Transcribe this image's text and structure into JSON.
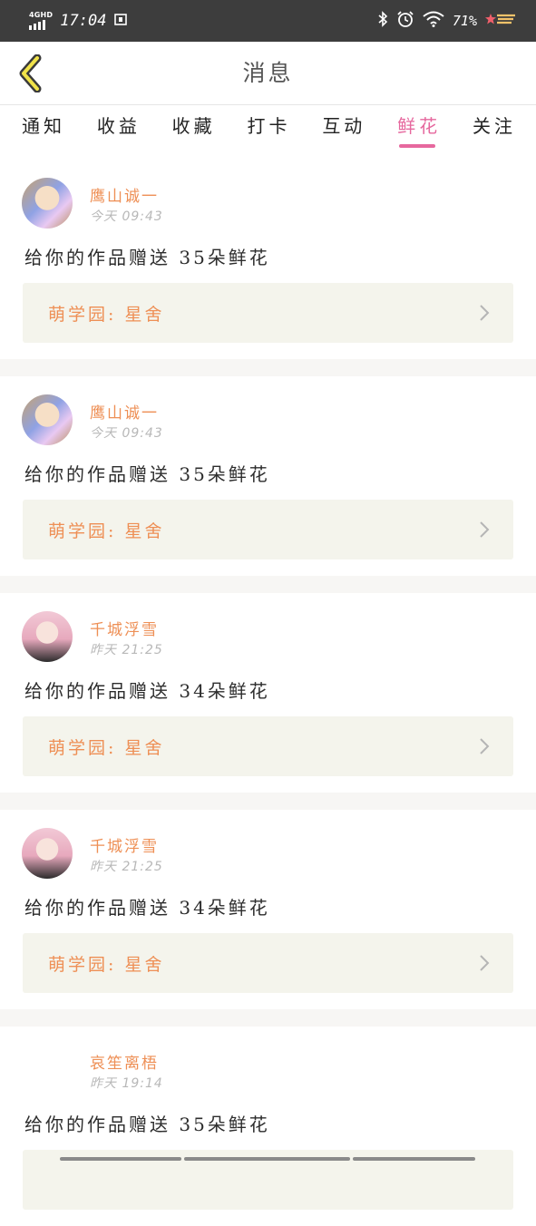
{
  "status": {
    "network": "4GHD",
    "time": "17:04",
    "battery": "71%"
  },
  "nav": {
    "title": "消息"
  },
  "tabs": [
    {
      "label": "通知",
      "active": false
    },
    {
      "label": "收益",
      "active": false
    },
    {
      "label": "收藏",
      "active": false
    },
    {
      "label": "打卡",
      "active": false
    },
    {
      "label": "互动",
      "active": false
    },
    {
      "label": "鲜花",
      "active": true
    },
    {
      "label": "关注",
      "active": false
    }
  ],
  "messages": [
    {
      "name": "鹰山诚一",
      "time": "今天 09:43",
      "text": "给你的作品赠送 35朵鲜花",
      "source": "萌学园: 星舍"
    },
    {
      "name": "鹰山诚一",
      "time": "今天 09:43",
      "text": "给你的作品赠送 35朵鲜花",
      "source": "萌学园: 星舍"
    },
    {
      "name": "千城浮雪",
      "time": "昨天 21:25",
      "text": "给你的作品赠送 34朵鲜花",
      "source": "萌学园: 星舍"
    },
    {
      "name": "千城浮雪",
      "time": "昨天 21:25",
      "text": "给你的作品赠送 34朵鲜花",
      "source": "萌学园: 星舍"
    },
    {
      "name": "哀笙离梧",
      "time": "昨天 19:14",
      "text": "给你的作品赠送 35朵鲜花",
      "source": ""
    }
  ],
  "colors": {
    "accent": "#e6689e",
    "username": "#ee8f55",
    "source_bg": "#f4f4ec",
    "status_bar": "#3d3d3d"
  },
  "icons": [
    "back-chevron-icon",
    "bluetooth-icon",
    "alarm-icon",
    "wifi-icon",
    "shooting-star-icon",
    "chevron-right-icon"
  ]
}
